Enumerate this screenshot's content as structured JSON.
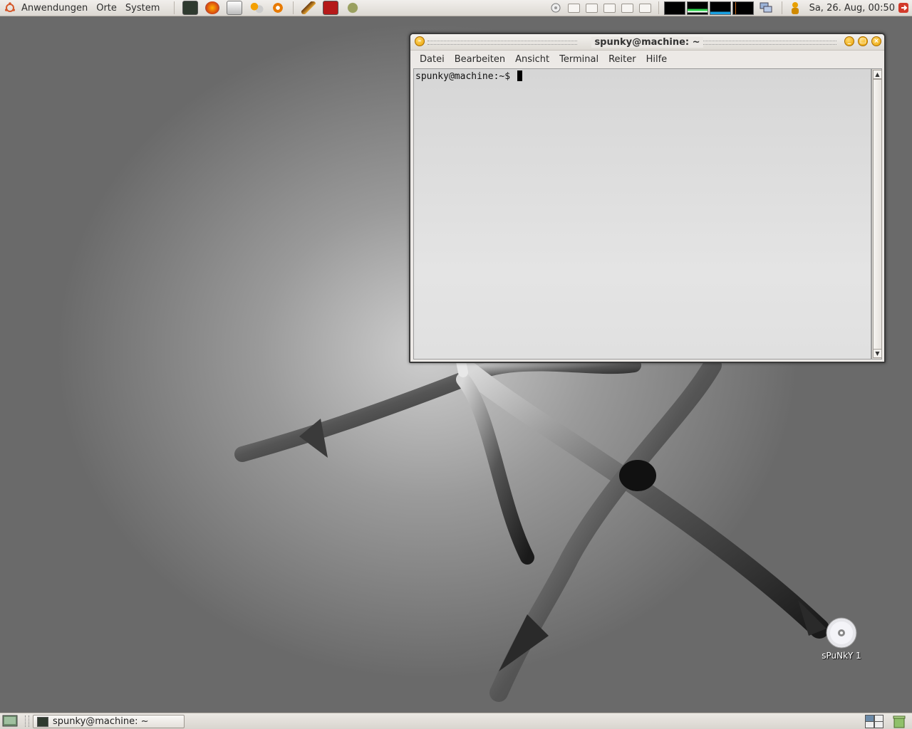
{
  "top_panel": {
    "menus": [
      "Anwendungen",
      "Orte",
      "System"
    ],
    "launchers": [
      "terminal-icon",
      "firefox-icon",
      "text-editor-icon",
      "people-icon",
      "blender-icon",
      "pen-icon",
      "presentation-icon",
      "record-icon"
    ],
    "clock": "Sa, 26. Aug, 00:50"
  },
  "window": {
    "title": "spunky@machine: ~",
    "menu": [
      "Datei",
      "Bearbeiten",
      "Ansicht",
      "Terminal",
      "Reiter",
      "Hilfe"
    ],
    "prompt": "spunky@machine:~$ "
  },
  "desktop": {
    "icon_label": "sPuNkY 1"
  },
  "bottom_panel": {
    "task_label": "spunky@machine: ~"
  }
}
